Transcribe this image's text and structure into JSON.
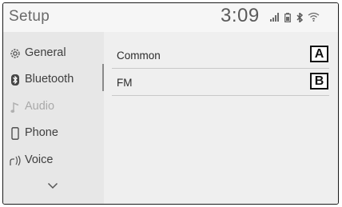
{
  "header": {
    "title": "Setup",
    "clock": "3:09",
    "status_icons": [
      "signal-icon",
      "battery-icon",
      "bluetooth-icon",
      "wifi-icon"
    ]
  },
  "sidebar": {
    "items": [
      {
        "label": "General",
        "icon": "gear-icon",
        "selected": false
      },
      {
        "label": "Bluetooth",
        "icon": "bluetooth-icon",
        "selected": false
      },
      {
        "label": "Audio",
        "icon": "music-note-icon",
        "selected": true
      },
      {
        "label": "Phone",
        "icon": "phone-icon",
        "selected": false
      },
      {
        "label": "Voice",
        "icon": "voice-icon",
        "selected": false
      }
    ],
    "more_icon": "chevron-down-icon"
  },
  "main": {
    "rows": [
      {
        "label": "Common",
        "callout": "A"
      },
      {
        "label": "FM",
        "callout": "B"
      }
    ]
  }
}
